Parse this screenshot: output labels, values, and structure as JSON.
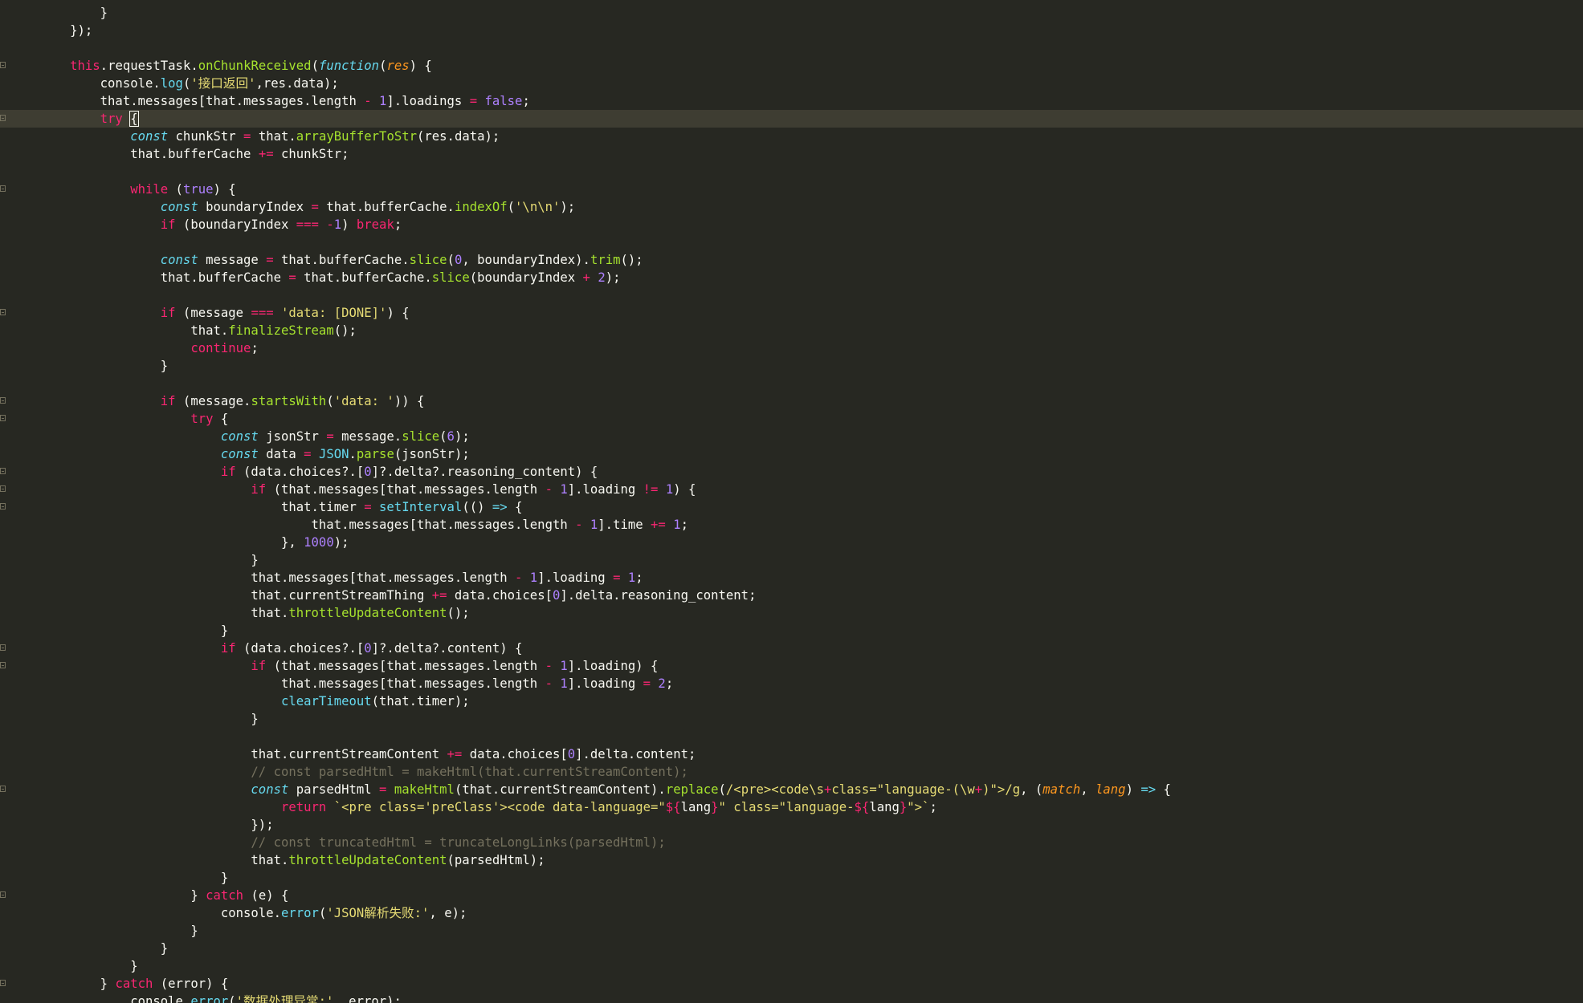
{
  "editor": {
    "fold_lines": [
      3,
      6,
      10,
      17,
      22,
      23,
      26,
      27,
      28,
      36,
      37,
      44,
      50,
      55
    ],
    "current_line": 6,
    "lines": [
      [
        [
          "d",
          "            }"
        ]
      ],
      [
        [
          "d",
          "        });"
        ]
      ],
      [
        [
          "d",
          ""
        ]
      ],
      [
        [
          "kw",
          "        this"
        ],
        [
          "d",
          "."
        ],
        [
          "d",
          "requestTask"
        ],
        [
          "d",
          "."
        ],
        [
          "fn",
          "onChunkReceived"
        ],
        [
          "d",
          "("
        ],
        [
          "st",
          "function"
        ],
        [
          "d",
          "("
        ],
        [
          "p",
          "res"
        ],
        [
          "d",
          ") {"
        ]
      ],
      [
        [
          "d",
          "            console."
        ],
        [
          "bf",
          "log"
        ],
        [
          "d",
          "("
        ],
        [
          "str",
          "'接口返回'"
        ],
        [
          "d",
          ",res.data);"
        ]
      ],
      [
        [
          "d",
          "            that.messages[that.messages.length "
        ],
        [
          "op",
          "-"
        ],
        [
          "d",
          " "
        ],
        [
          "num",
          "1"
        ],
        [
          "d",
          "].loadings "
        ],
        [
          "op",
          "="
        ],
        [
          "d",
          " "
        ],
        [
          "num",
          "false"
        ],
        [
          "d",
          ";"
        ]
      ],
      [
        [
          "kw",
          "            try"
        ],
        [
          "d",
          " "
        ],
        [
          "d",
          "{"
        ]
      ],
      [
        [
          "st",
          "                const"
        ],
        [
          "d",
          " chunkStr "
        ],
        [
          "op",
          "="
        ],
        [
          "d",
          " that."
        ],
        [
          "fn",
          "arrayBufferToStr"
        ],
        [
          "d",
          "(res.data);"
        ]
      ],
      [
        [
          "d",
          "                that.bufferCache "
        ],
        [
          "op",
          "+="
        ],
        [
          "d",
          " chunkStr;"
        ]
      ],
      [
        [
          "d",
          ""
        ]
      ],
      [
        [
          "kw",
          "                while"
        ],
        [
          "d",
          " ("
        ],
        [
          "num",
          "true"
        ],
        [
          "d",
          ") {"
        ]
      ],
      [
        [
          "st",
          "                    const"
        ],
        [
          "d",
          " boundaryIndex "
        ],
        [
          "op",
          "="
        ],
        [
          "d",
          " that.bufferCache."
        ],
        [
          "fn",
          "indexOf"
        ],
        [
          "d",
          "("
        ],
        [
          "str",
          "'\\n\\n'"
        ],
        [
          "d",
          ");"
        ]
      ],
      [
        [
          "kw",
          "                    if"
        ],
        [
          "d",
          " (boundaryIndex "
        ],
        [
          "op",
          "==="
        ],
        [
          "d",
          " "
        ],
        [
          "op",
          "-"
        ],
        [
          "num",
          "1"
        ],
        [
          "d",
          ") "
        ],
        [
          "kw",
          "break"
        ],
        [
          "d",
          ";"
        ]
      ],
      [
        [
          "d",
          ""
        ]
      ],
      [
        [
          "st",
          "                    const"
        ],
        [
          "d",
          " message "
        ],
        [
          "op",
          "="
        ],
        [
          "d",
          " that.bufferCache."
        ],
        [
          "fn",
          "slice"
        ],
        [
          "d",
          "("
        ],
        [
          "num",
          "0"
        ],
        [
          "d",
          ", boundaryIndex)."
        ],
        [
          "fn",
          "trim"
        ],
        [
          "d",
          "();"
        ]
      ],
      [
        [
          "d",
          "                    that.bufferCache "
        ],
        [
          "op",
          "="
        ],
        [
          "d",
          " that.bufferCache."
        ],
        [
          "fn",
          "slice"
        ],
        [
          "d",
          "(boundaryIndex "
        ],
        [
          "op",
          "+"
        ],
        [
          "d",
          " "
        ],
        [
          "num",
          "2"
        ],
        [
          "d",
          ");"
        ]
      ],
      [
        [
          "d",
          ""
        ]
      ],
      [
        [
          "kw",
          "                    if"
        ],
        [
          "d",
          " (message "
        ],
        [
          "op",
          "==="
        ],
        [
          "d",
          " "
        ],
        [
          "str",
          "'data: [DONE]'"
        ],
        [
          "d",
          ") {"
        ]
      ],
      [
        [
          "d",
          "                        that."
        ],
        [
          "fn",
          "finalizeStream"
        ],
        [
          "d",
          "();"
        ]
      ],
      [
        [
          "kw",
          "                        continue"
        ],
        [
          "d",
          ";"
        ]
      ],
      [
        [
          "d",
          "                    }"
        ]
      ],
      [
        [
          "d",
          ""
        ]
      ],
      [
        [
          "kw",
          "                    if"
        ],
        [
          "d",
          " (message."
        ],
        [
          "fn",
          "startsWith"
        ],
        [
          "d",
          "("
        ],
        [
          "str",
          "'data: '"
        ],
        [
          "d",
          ")) {"
        ]
      ],
      [
        [
          "kw",
          "                        try"
        ],
        [
          "d",
          " {"
        ]
      ],
      [
        [
          "st",
          "                            const"
        ],
        [
          "d",
          " jsonStr "
        ],
        [
          "op",
          "="
        ],
        [
          "d",
          " message."
        ],
        [
          "fn",
          "slice"
        ],
        [
          "d",
          "("
        ],
        [
          "num",
          "6"
        ],
        [
          "d",
          ");"
        ]
      ],
      [
        [
          "st",
          "                            const"
        ],
        [
          "d",
          " data "
        ],
        [
          "op",
          "="
        ],
        [
          "d",
          " "
        ],
        [
          "bf",
          "JSON"
        ],
        [
          "d",
          "."
        ],
        [
          "fn",
          "parse"
        ],
        [
          "d",
          "(jsonStr);"
        ]
      ],
      [
        [
          "kw",
          "                            if"
        ],
        [
          "d",
          " (data.choices?.["
        ],
        [
          "num",
          "0"
        ],
        [
          "d",
          "]?.delta?.reasoning_content) {"
        ]
      ],
      [
        [
          "kw",
          "                                if"
        ],
        [
          "d",
          " (that.messages[that.messages.length "
        ],
        [
          "op",
          "-"
        ],
        [
          "d",
          " "
        ],
        [
          "num",
          "1"
        ],
        [
          "d",
          "].loading "
        ],
        [
          "op",
          "!="
        ],
        [
          "d",
          " "
        ],
        [
          "num",
          "1"
        ],
        [
          "d",
          ") {"
        ]
      ],
      [
        [
          "d",
          "                                    that.timer "
        ],
        [
          "op",
          "="
        ],
        [
          "d",
          " "
        ],
        [
          "bf",
          "setInterval"
        ],
        [
          "d",
          "(() "
        ],
        [
          "st",
          "=>"
        ],
        [
          "d",
          " {"
        ]
      ],
      [
        [
          "d",
          "                                        that.messages[that.messages.length "
        ],
        [
          "op",
          "-"
        ],
        [
          "d",
          " "
        ],
        [
          "num",
          "1"
        ],
        [
          "d",
          "].time "
        ],
        [
          "op",
          "+="
        ],
        [
          "d",
          " "
        ],
        [
          "num",
          "1"
        ],
        [
          "d",
          ";"
        ]
      ],
      [
        [
          "d",
          "                                    }, "
        ],
        [
          "num",
          "1000"
        ],
        [
          "d",
          ");"
        ]
      ],
      [
        [
          "d",
          "                                }"
        ]
      ],
      [
        [
          "d",
          "                                that.messages[that.messages.length "
        ],
        [
          "op",
          "-"
        ],
        [
          "d",
          " "
        ],
        [
          "num",
          "1"
        ],
        [
          "d",
          "].loading "
        ],
        [
          "op",
          "="
        ],
        [
          "d",
          " "
        ],
        [
          "num",
          "1"
        ],
        [
          "d",
          ";"
        ]
      ],
      [
        [
          "d",
          "                                that.currentStreamThing "
        ],
        [
          "op",
          "+="
        ],
        [
          "d",
          " data.choices["
        ],
        [
          "num",
          "0"
        ],
        [
          "d",
          "].delta.reasoning_content;"
        ]
      ],
      [
        [
          "d",
          "                                that."
        ],
        [
          "fn",
          "throttleUpdateContent"
        ],
        [
          "d",
          "();"
        ]
      ],
      [
        [
          "d",
          "                            }"
        ]
      ],
      [
        [
          "kw",
          "                            if"
        ],
        [
          "d",
          " (data.choices?.["
        ],
        [
          "num",
          "0"
        ],
        [
          "d",
          "]?.delta?.content) {"
        ]
      ],
      [
        [
          "kw",
          "                                if"
        ],
        [
          "d",
          " (that.messages[that.messages.length "
        ],
        [
          "op",
          "-"
        ],
        [
          "d",
          " "
        ],
        [
          "num",
          "1"
        ],
        [
          "d",
          "].loading) {"
        ]
      ],
      [
        [
          "d",
          "                                    that.messages[that.messages.length "
        ],
        [
          "op",
          "-"
        ],
        [
          "d",
          " "
        ],
        [
          "num",
          "1"
        ],
        [
          "d",
          "].loading "
        ],
        [
          "op",
          "="
        ],
        [
          "d",
          " "
        ],
        [
          "num",
          "2"
        ],
        [
          "d",
          ";"
        ]
      ],
      [
        [
          "bf",
          "                                    clearTimeout"
        ],
        [
          "d",
          "(that.timer);"
        ]
      ],
      [
        [
          "d",
          "                                }"
        ]
      ],
      [
        [
          "d",
          ""
        ]
      ],
      [
        [
          "d",
          "                                that.currentStreamContent "
        ],
        [
          "op",
          "+="
        ],
        [
          "d",
          " data.choices["
        ],
        [
          "num",
          "0"
        ],
        [
          "d",
          "].delta.content;"
        ]
      ],
      [
        [
          "cm",
          "                                // const parsedHtml = makeHtml(that.currentStreamContent);"
        ]
      ],
      [
        [
          "st",
          "                                const"
        ],
        [
          "d",
          " parsedHtml "
        ],
        [
          "op",
          "="
        ],
        [
          "d",
          " "
        ],
        [
          "fn",
          "makeHtml"
        ],
        [
          "d",
          "(that.currentStreamContent)."
        ],
        [
          "fn",
          "replace"
        ],
        [
          "d",
          "("
        ],
        [
          "str",
          "/<pre><code\\s"
        ],
        [
          "op",
          "+"
        ],
        [
          "str",
          "class=\"language-(\\w"
        ],
        [
          "op",
          "+"
        ],
        [
          "str",
          ")\">/g"
        ],
        [
          "d",
          ", ("
        ],
        [
          "p",
          "match"
        ],
        [
          "d",
          ", "
        ],
        [
          "p",
          "lang"
        ],
        [
          "d",
          ") "
        ],
        [
          "st",
          "=>"
        ],
        [
          "d",
          " {"
        ]
      ],
      [
        [
          "kw",
          "                                    return"
        ],
        [
          "d",
          " "
        ],
        [
          "str",
          "`<pre class='preClass'><code data-language=\""
        ],
        [
          "kw",
          "${"
        ],
        [
          "d",
          "lang"
        ],
        [
          "kw",
          "}"
        ],
        [
          "str",
          "\" class=\"language-"
        ],
        [
          "kw",
          "${"
        ],
        [
          "d",
          "lang"
        ],
        [
          "kw",
          "}"
        ],
        [
          "str",
          "\">`"
        ],
        [
          "d",
          ";"
        ]
      ],
      [
        [
          "d",
          "                                });"
        ]
      ],
      [
        [
          "cm",
          "                                // const truncatedHtml = truncateLongLinks(parsedHtml);"
        ]
      ],
      [
        [
          "d",
          "                                that."
        ],
        [
          "fn",
          "throttleUpdateContent"
        ],
        [
          "d",
          "(parsedHtml);"
        ]
      ],
      [
        [
          "d",
          "                            }"
        ]
      ],
      [
        [
          "d",
          "                        } "
        ],
        [
          "kw",
          "catch"
        ],
        [
          "d",
          " (e) {"
        ]
      ],
      [
        [
          "d",
          "                            console."
        ],
        [
          "bf",
          "error"
        ],
        [
          "d",
          "("
        ],
        [
          "str",
          "'JSON解析失败:'"
        ],
        [
          "d",
          ", e);"
        ]
      ],
      [
        [
          "d",
          "                        }"
        ]
      ],
      [
        [
          "d",
          "                    }"
        ]
      ],
      [
        [
          "d",
          "                }"
        ]
      ],
      [
        [
          "d",
          "            } "
        ],
        [
          "kw",
          "catch"
        ],
        [
          "d",
          " (error) {"
        ]
      ],
      [
        [
          "d",
          "                console."
        ],
        [
          "bf",
          "error"
        ],
        [
          "d",
          "("
        ],
        [
          "str",
          "'数据处理异常:'"
        ],
        [
          "d",
          ", error);"
        ]
      ]
    ]
  }
}
